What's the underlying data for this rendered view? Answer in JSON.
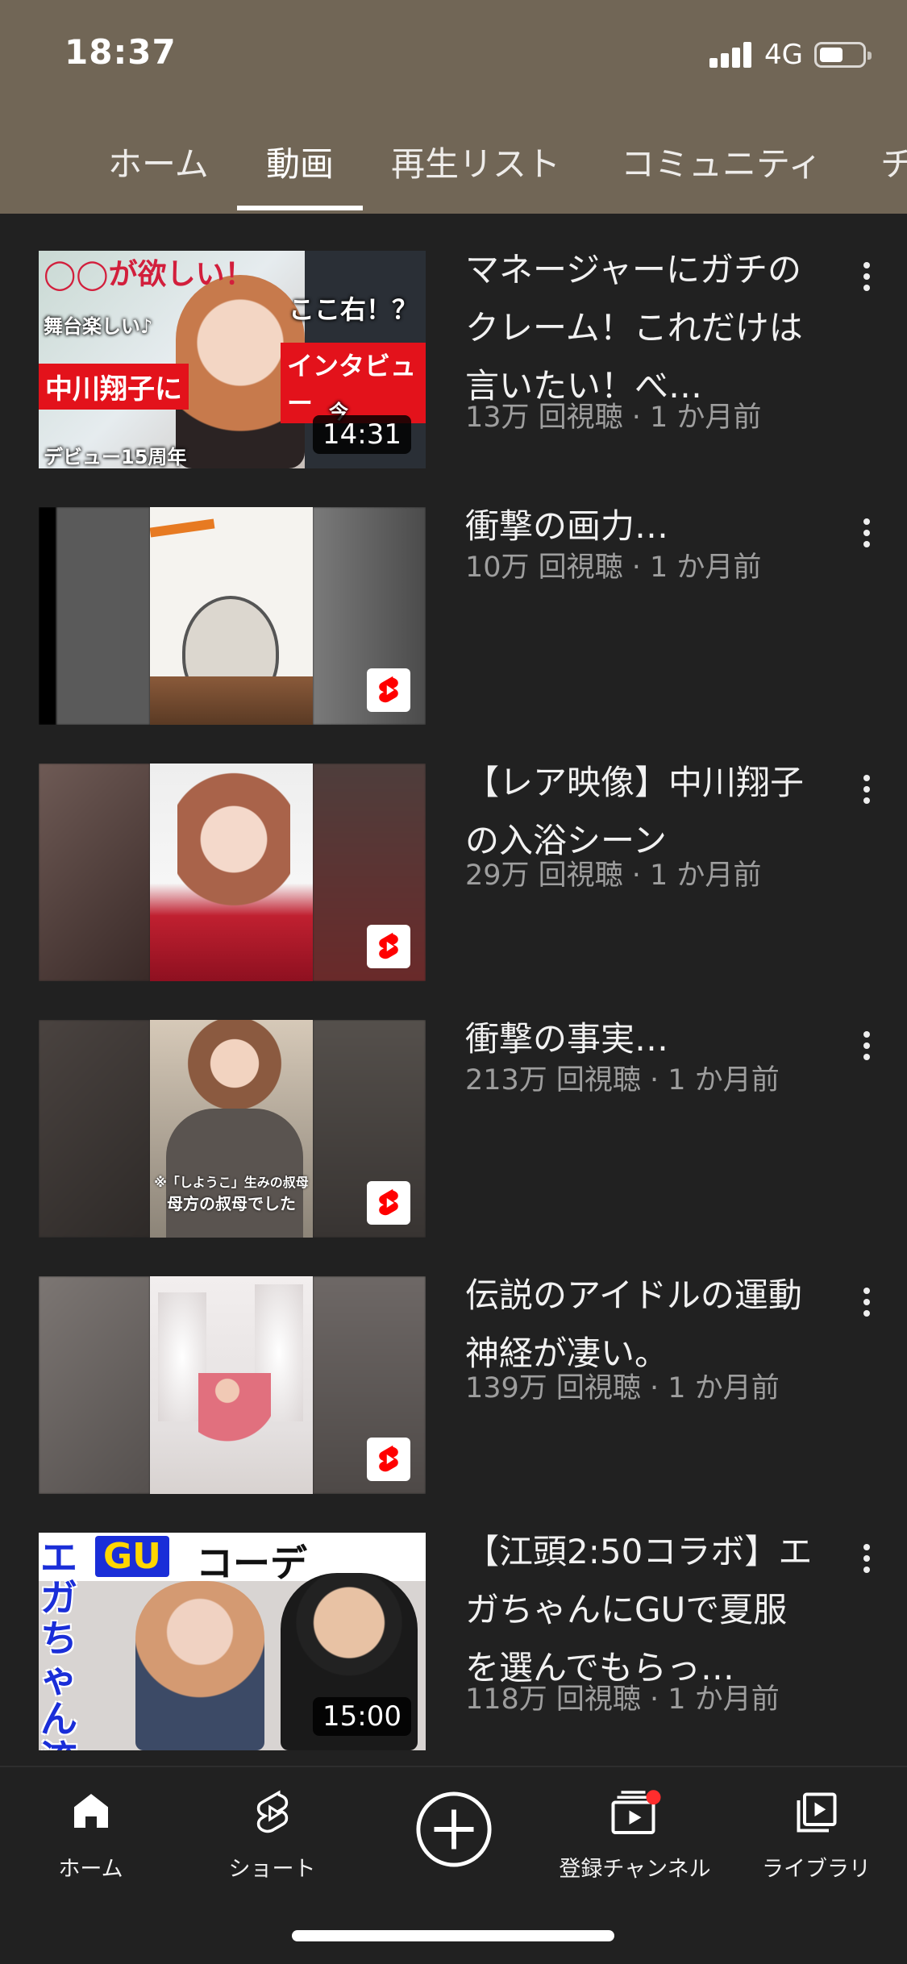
{
  "status_bar": {
    "time": "18:37",
    "network": "4G"
  },
  "tabs": [
    {
      "label": "ホーム"
    },
    {
      "label": "動画"
    },
    {
      "label": "再生リスト"
    },
    {
      "label": "コミュニティ"
    },
    {
      "label": "チ"
    }
  ],
  "active_tab": "動画",
  "videos": [
    {
      "title": "マネージャーにガチのクレーム！これだけは言いたい！べ…",
      "meta": "13万 回視聴 · 1 か月前",
      "duration": "14:31",
      "thumb_text": {
        "headline": "◯◯が欲しい！",
        "left_tag": "舞台楽しい♪",
        "right_tag": "ここ右！？",
        "name_banner": "中川翔子に",
        "interview_banner": "インタビュー",
        "footer": "デビュー15周年",
        "corner": "今"
      }
    },
    {
      "title": "衝撃の画力…",
      "meta": "10万 回視聴 · 1 か月前",
      "is_short": true
    },
    {
      "title": "【レア映像】中川翔子の入浴シーン",
      "meta": "29万 回視聴 · 1 か月前",
      "is_short": true
    },
    {
      "title": "衝撃の事実…",
      "meta": "213万 回視聴 · 1 か月前",
      "is_short": true,
      "thumb_caption": {
        "line1": "※「しようこ」生みの叔母",
        "line2": "母方の叔母でした"
      }
    },
    {
      "title": "伝説のアイドルの運動神経が凄い。",
      "meta": "139万 回視聴 · 1 か月前",
      "is_short": true
    },
    {
      "title": "【江頭2:50コラボ】エガちゃんにGUで夏服を選んでもらっ…",
      "meta": "118万 回視聴 · 1 か月前",
      "duration": "15:00",
      "thumb_text": {
        "gu": "GU",
        "coordinate": "コーデ",
        "vertical": "エガちゃん流"
      }
    }
  ],
  "bottom_nav": [
    {
      "label": "ホーム",
      "icon": "home-icon"
    },
    {
      "label": "ショート",
      "icon": "shorts-icon"
    },
    {
      "label": "",
      "icon": "create-plus-icon"
    },
    {
      "label": "登録チャンネル",
      "icon": "subscriptions-icon"
    },
    {
      "label": "ライブラリ",
      "icon": "library-icon"
    }
  ],
  "colors": {
    "header_bg": "#716656",
    "page_bg": "#212121",
    "notification_dot": "#ff2d2d"
  }
}
